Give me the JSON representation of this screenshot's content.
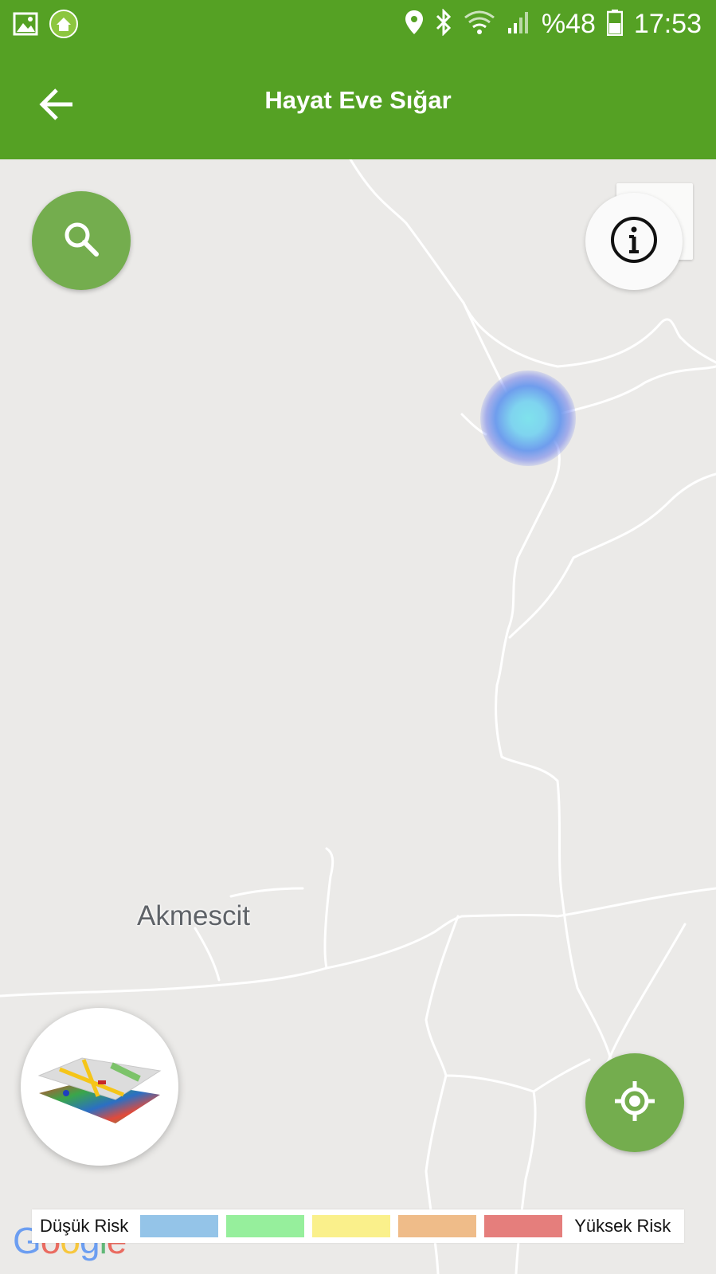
{
  "status_bar": {
    "battery_percent": "%48",
    "time": "17:53"
  },
  "app_bar": {
    "title": "Hayat Eve Sığar"
  },
  "map": {
    "place_label": "Akmescit"
  },
  "legend": {
    "low_label": "Düşük Risk",
    "high_label": "Yüksek Risk",
    "colors": [
      "#94c4e8",
      "#96ef9c",
      "#faf08b",
      "#efbc89",
      "#e57e7c"
    ]
  },
  "attribution": {
    "logo_text": "Google"
  },
  "theme": {
    "primary": "#55a124",
    "fab": "#74ad4e",
    "heat_center": "#7fe2ec"
  }
}
